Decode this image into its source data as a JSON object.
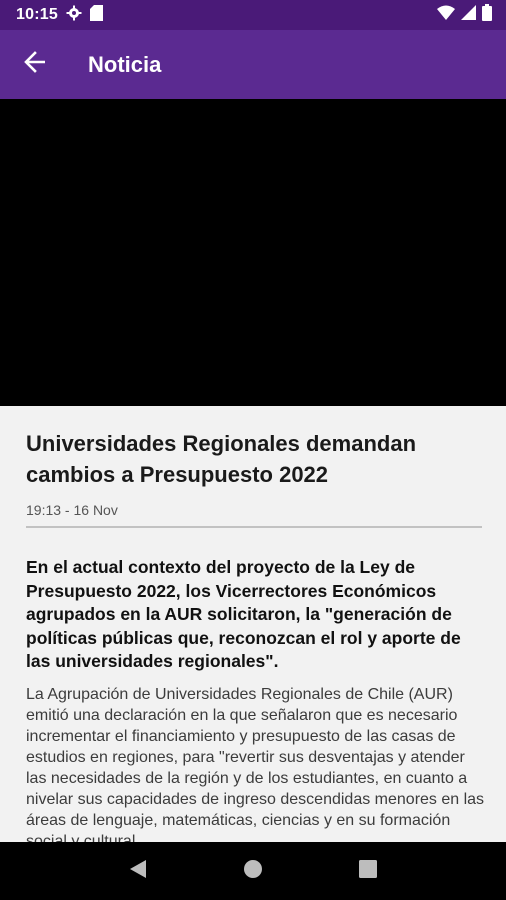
{
  "status_bar": {
    "time": "10:15",
    "icons": [
      "gear-icon",
      "sd-card-icon",
      "wifi-icon",
      "signal-icon",
      "battery-icon"
    ]
  },
  "app_bar": {
    "title": "Noticia",
    "back_icon": "arrow-left-icon",
    "color": "#5b2a91"
  },
  "article": {
    "headline": "Universidades Regionales demandan cambios a Presupuesto 2022",
    "meta": "19:13 - 16 Nov",
    "lead": "En el actual contexto del proyecto de la Ley de Presupuesto 2022, los Vicerrectores Económicos agrupados en la AUR solicitaron, la \"generación de políticas públicas que, reconozcan el rol y aporte de las universidades regionales\".",
    "body": "La Agrupación de Universidades Regionales de Chile (AUR) emitió una declaración en la que señalaron que es necesario incrementar el financiamiento y presupuesto de las casas de estudios en regiones, para \"revertir sus desventajas y atender las necesidades de la región y de los estudiantes, en cuanto a nivelar sus capacidades de ingreso descendidas menores en las áreas de lenguaje, matemáticas, ciencias y en su formación social y cultural"
  },
  "nav_bar": {
    "icons": [
      "back-triangle-icon",
      "home-circle-icon",
      "recents-square-icon"
    ]
  }
}
